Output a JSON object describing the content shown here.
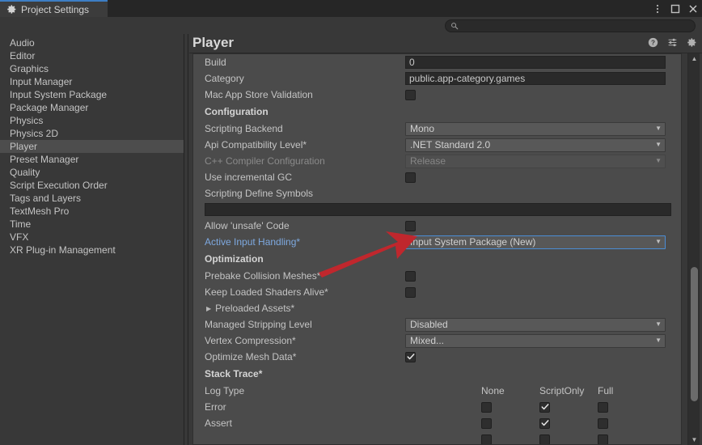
{
  "window": {
    "tab_label": "Project Settings",
    "tab_icon": "gear-icon",
    "buttons": {
      "menu": "⋮",
      "maximize": "☐",
      "close": "✕"
    }
  },
  "search": {
    "placeholder": "",
    "value": "",
    "icon": "search-icon"
  },
  "sidebar": {
    "items": [
      {
        "label": "Audio",
        "selected": false
      },
      {
        "label": "Editor",
        "selected": false
      },
      {
        "label": "Graphics",
        "selected": false
      },
      {
        "label": "Input Manager",
        "selected": false
      },
      {
        "label": "Input System Package",
        "selected": false
      },
      {
        "label": "Package Manager",
        "selected": false
      },
      {
        "label": "Physics",
        "selected": false
      },
      {
        "label": "Physics 2D",
        "selected": false
      },
      {
        "label": "Player",
        "selected": true
      },
      {
        "label": "Preset Manager",
        "selected": false
      },
      {
        "label": "Quality",
        "selected": false
      },
      {
        "label": "Script Execution Order",
        "selected": false
      },
      {
        "label": "Tags and Layers",
        "selected": false
      },
      {
        "label": "TextMesh Pro",
        "selected": false
      },
      {
        "label": "Time",
        "selected": false
      },
      {
        "label": "VFX",
        "selected": false
      },
      {
        "label": "XR Plug-in Management",
        "selected": false
      }
    ]
  },
  "panel": {
    "title": "Player",
    "header_icons": [
      {
        "name": "help-icon",
        "glyph": "?"
      },
      {
        "name": "preset-icon",
        "glyph": "preset"
      },
      {
        "name": "gear-icon",
        "glyph": "gear"
      }
    ]
  },
  "form": {
    "build_label": "Build",
    "build_value": "0",
    "category_label": "Category",
    "category_value": "public.app-category.games",
    "mac_validation_label": "Mac App Store Validation",
    "mac_validation_checked": false,
    "configuration_header": "Configuration",
    "scripting_backend_label": "Scripting Backend",
    "scripting_backend_value": "Mono",
    "api_compat_label": "Api Compatibility Level*",
    "api_compat_value": ".NET Standard 2.0",
    "cpp_compiler_label": "C++ Compiler Configuration",
    "cpp_compiler_value": "Release",
    "incremental_gc_label": "Use incremental GC",
    "incremental_gc_checked": false,
    "define_symbols_label": "Scripting Define Symbols",
    "define_symbols_value": "",
    "unsafe_code_label": "Allow 'unsafe' Code",
    "unsafe_code_checked": false,
    "active_input_label": "Active Input Handling*",
    "active_input_value": "Input System Package (New)",
    "optimization_header": "Optimization",
    "prebake_label": "Prebake Collision Meshes*",
    "prebake_checked": false,
    "keep_shaders_label": "Keep Loaded Shaders Alive*",
    "keep_shaders_checked": false,
    "preloaded_assets_label": "Preloaded Assets*",
    "managed_stripping_label": "Managed Stripping Level",
    "managed_stripping_value": "Disabled",
    "vertex_compression_label": "Vertex Compression*",
    "vertex_compression_value": "Mixed...",
    "optimize_mesh_label": "Optimize Mesh Data*",
    "optimize_mesh_checked": true,
    "stack_trace_header": "Stack Trace*",
    "log_type_label": "Log Type",
    "stack_columns": [
      "None",
      "ScriptOnly",
      "Full"
    ],
    "stack_rows": [
      {
        "label": "Error",
        "none": false,
        "scriptonly": true,
        "full": false
      },
      {
        "label": "Assert",
        "none": false,
        "scriptonly": true,
        "full": false
      }
    ]
  },
  "colors": {
    "accent_blue": "#3d7ec4",
    "focus_blue": "#4b8ed6",
    "label_blue": "#7ea9e0",
    "arrow_red": "#c0272d",
    "panel_bg": "#4b4b4b",
    "window_bg": "#383838"
  }
}
